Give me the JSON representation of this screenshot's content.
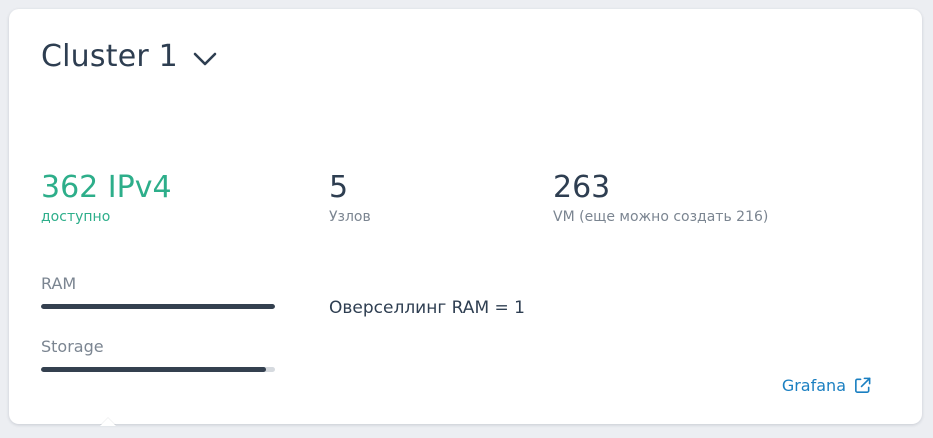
{
  "cluster": {
    "name": "Cluster 1",
    "dropdown_icon": "chevron-down-icon"
  },
  "stats": {
    "ipv4": {
      "value": "362 IPv4",
      "caption": "доступно"
    },
    "nodes": {
      "value": "5",
      "caption": "Узлов"
    },
    "vm": {
      "value": "263",
      "caption": "VM (еще можно создать 216)"
    }
  },
  "resources": {
    "ram": {
      "label": "RAM",
      "usage_fraction": 1.0
    },
    "storage": {
      "label": "Storage",
      "usage_fraction": 0.96
    }
  },
  "overselling": "Оверселлинг RAM = 1",
  "grafana": {
    "label": "Grafana",
    "icon": "external-link-icon"
  },
  "colors": {
    "accent_green": "#2dae8a",
    "link_blue": "#1a7fc1",
    "text_dark": "#2e3e51",
    "text_muted": "#7b8591",
    "bar_fill": "#34404f",
    "bar_track": "#d6dadf"
  }
}
